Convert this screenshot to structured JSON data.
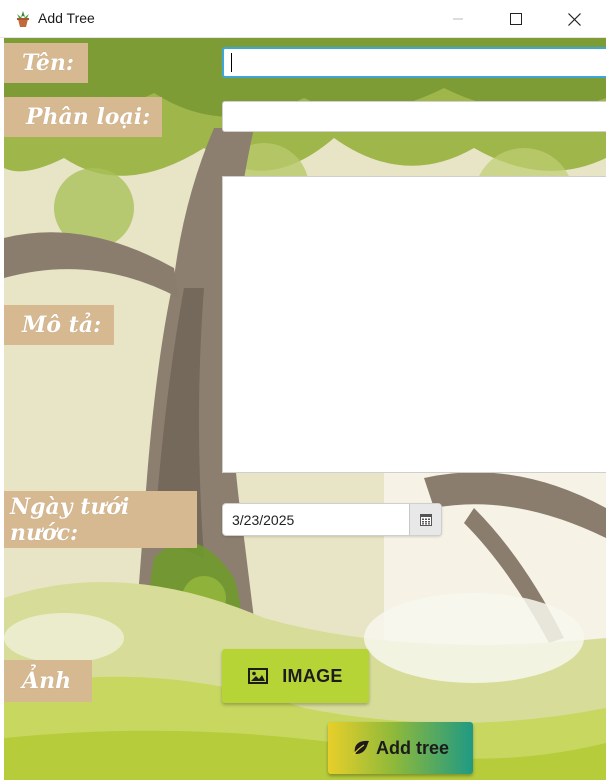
{
  "window": {
    "title": "Add Tree",
    "controls": {
      "minimize": "minimize",
      "maximize": "maximize",
      "close": "close"
    }
  },
  "form": {
    "name_label": "Tên:",
    "category_label": "Phân loại:",
    "description_label": "Mô tả:",
    "watering_date_label": "Ngày tưới nước:",
    "image_label": "Ảnh",
    "name_value": "",
    "category_value": "",
    "description_value": "",
    "watering_date_value": "3/23/2025"
  },
  "buttons": {
    "image_label": "IMAGE",
    "image_icon": "image-icon",
    "add_label": "Add tree",
    "add_icon": "leaf-icon",
    "calendar_icon": "calendar-icon"
  },
  "colors": {
    "label_bg": "#d7b991",
    "image_button": "#b7d437",
    "add_button_gradient": [
      "#e7cf2a",
      "#8fb93a",
      "#1f9a84"
    ],
    "focus_border": "#3da8d8"
  }
}
